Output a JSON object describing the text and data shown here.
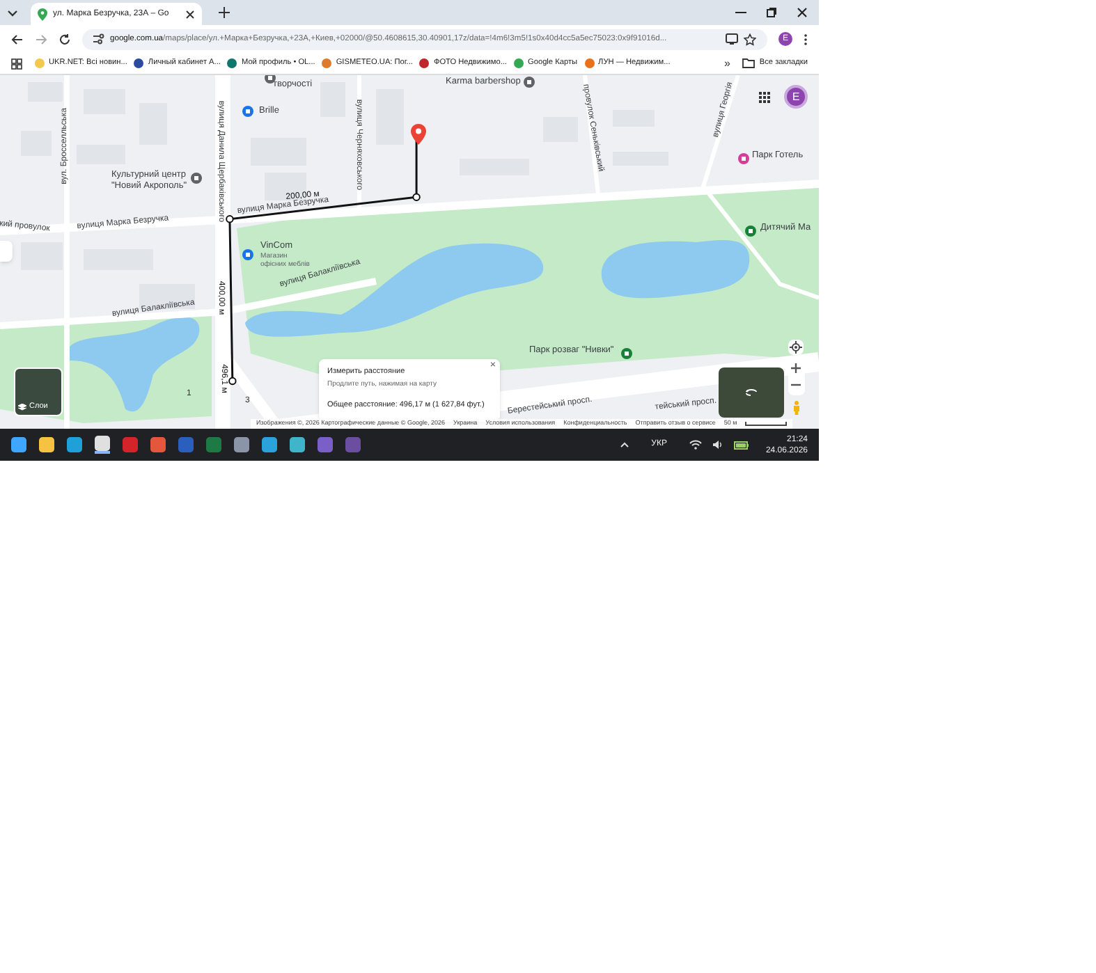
{
  "browser": {
    "tab": {
      "title": "ул. Марка Безручка, 23А – Go",
      "selected": true
    },
    "address": {
      "host": "google.com.ua",
      "path": "/maps/place/ул.+Марка+Безручка,+23А,+Киев,+02000/@50.4608615,30.40901,17z/data=!4m6!3m5!1s0x40d4cc5a5ec75023:0x9f91016d..."
    },
    "bookmarks": [
      {
        "label": "UKR.NET: Всі новин...",
        "color": "#f2c94c"
      },
      {
        "label": "Личный кабинет А...",
        "color": "#2b4aa0"
      },
      {
        "label": "Мой профиль • OL...",
        "color": "#0f766e"
      },
      {
        "label": "GISMETEO.UA: Пог...",
        "color": "#e07a2b"
      },
      {
        "label": "ФОТО Недвижимо...",
        "color": "#c0262d"
      },
      {
        "label": "Google Карты",
        "color": "#34a853"
      },
      {
        "label": "ЛУН — Недвижим...",
        "color": "#e8711a"
      }
    ],
    "overflow": "»",
    "all_bookmarks": "Все закладки",
    "profile_initial": "E"
  },
  "map": {
    "labels": [
      {
        "kind": "place",
        "text": "творчості"
      },
      {
        "kind": "place",
        "text": "Brille"
      },
      {
        "kind": "place",
        "text": "Karma barbershop"
      },
      {
        "kind": "place",
        "text": "Культурний центр\n\"Новий Акрополь\""
      },
      {
        "kind": "place",
        "text": "Парк Готель"
      },
      {
        "kind": "place",
        "text": "Дитячий Ма"
      },
      {
        "kind": "place",
        "text": "VinCom"
      },
      {
        "kind": "subtitle",
        "text": "Магазин\nофісних меблів"
      },
      {
        "kind": "place",
        "text": "Парк розваг \"Нивки\""
      },
      {
        "kind": "street",
        "text": "вул. Бросселльська"
      },
      {
        "kind": "street",
        "text": "вулиця Данила Щербаківського"
      },
      {
        "kind": "street",
        "text": "вулиця Черняховського"
      },
      {
        "kind": "street",
        "text": "провулок Сеньківський"
      },
      {
        "kind": "street",
        "text": "вулиця Георгія"
      },
      {
        "kind": "street",
        "text": "вулиця Марка Безручка"
      },
      {
        "kind": "street",
        "text": "вулиця Марка Безручка"
      },
      {
        "kind": "street",
        "text": "кий провулок"
      },
      {
        "kind": "street",
        "text": "вулиця Балаклiївська"
      },
      {
        "kind": "street",
        "text": "вулиця Балаклiївська"
      },
      {
        "kind": "street",
        "text": "Берестейський просп."
      },
      {
        "kind": "street",
        "text": "тейський просп."
      },
      {
        "kind": "measure",
        "text": "200,00 м"
      },
      {
        "kind": "measure",
        "text": "400,00 м"
      },
      {
        "kind": "measure",
        "text": "496,1 м"
      },
      {
        "kind": "road_number",
        "text": "1"
      },
      {
        "kind": "road_number",
        "text": "3"
      }
    ],
    "measure_card": {
      "title": "Измерить расстояние",
      "hint": "Продлите путь, нажимая на карту",
      "total": "Общее расстояние: 496,17 м (1 627,84 фут.)",
      "close": "×"
    },
    "layers_label": "Слои",
    "footer": [
      "Изображения ©, 2026 Картографические данные © Google, 2026",
      "Украина",
      "Условия использования",
      "Конфиденциальность",
      "Отправить отзыв о сервисе"
    ],
    "scale": "50 м",
    "account_initial": "E"
  },
  "taskbar": {
    "language": "УКР",
    "time": "21:24",
    "date": "24.06.2026"
  }
}
